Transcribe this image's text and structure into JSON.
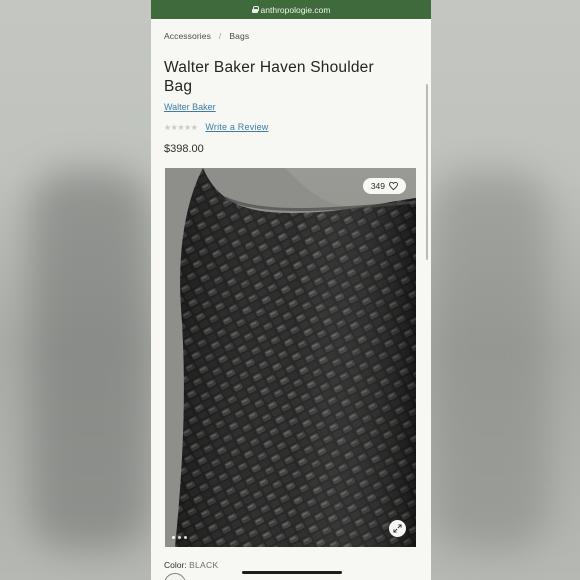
{
  "browser": {
    "url": "anthropologie.com"
  },
  "breadcrumb": {
    "items": [
      "Accessories",
      "Bags"
    ],
    "separator": "/"
  },
  "product": {
    "title": "Walter Baker Haven Shoulder Bag",
    "brand": "Walter Baker",
    "rating_stars": "★★★★★",
    "review_link": "Write a Review",
    "price": "$398.00",
    "like_count": "349",
    "color_label": "Color:",
    "color_value": "BLACK"
  },
  "gallery": {
    "dot_count": 3,
    "active_dot": 0
  },
  "colors": {
    "brand_green": "#3f6b3c",
    "link_blue": "#3d7ca6",
    "page_bg": "#f7f8f3"
  }
}
